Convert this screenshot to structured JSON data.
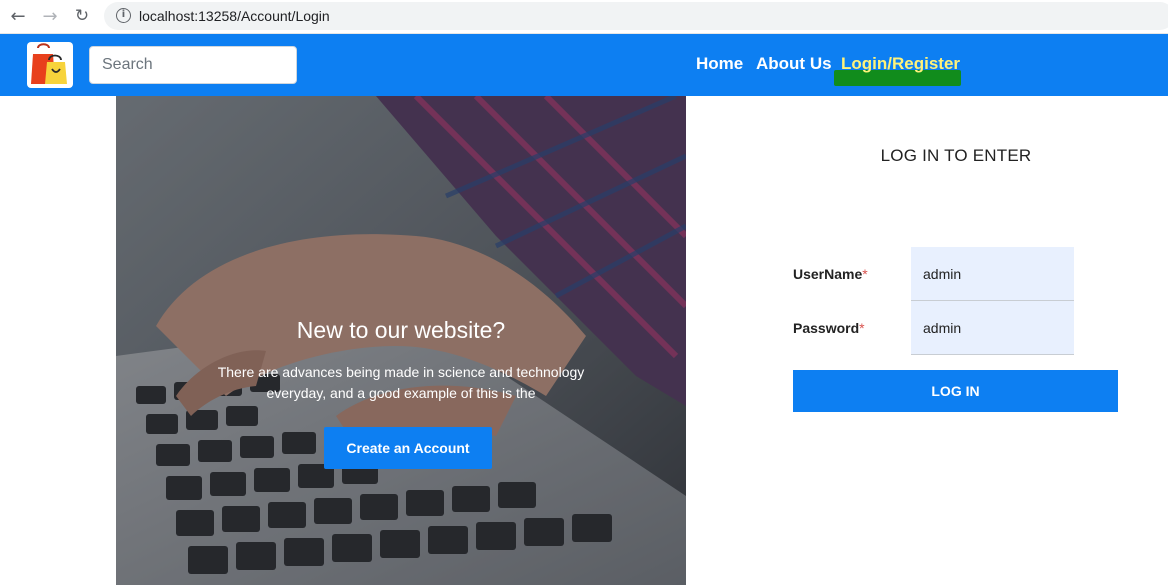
{
  "browser": {
    "url": "localhost:13258/Account/Login",
    "back_icon": "arrow-left-icon",
    "forward_icon": "arrow-right-icon",
    "reload_icon": "reload-icon",
    "info_icon": "info-circle-icon"
  },
  "navbar": {
    "logo_icon": "shopping-bags-icon",
    "search_placeholder": "Search",
    "links": [
      {
        "label": "Home"
      },
      {
        "label": "About Us"
      },
      {
        "label": "Login/Register"
      }
    ],
    "bg_color": "#0d7ff2",
    "active_link_color": "#fff27a",
    "active_link_highlight": "#118c1c"
  },
  "hero": {
    "title": "New to our website?",
    "text": "There are advances being made in science and technology everyday, and a good example of this is the",
    "button_label": "Create an Account"
  },
  "login": {
    "heading": "LOG IN TO ENTER",
    "username_label": "UserName",
    "password_label": "Password",
    "required_mark": "*",
    "username_value": "admin",
    "password_value": "admin",
    "button_label": "LOG IN"
  }
}
